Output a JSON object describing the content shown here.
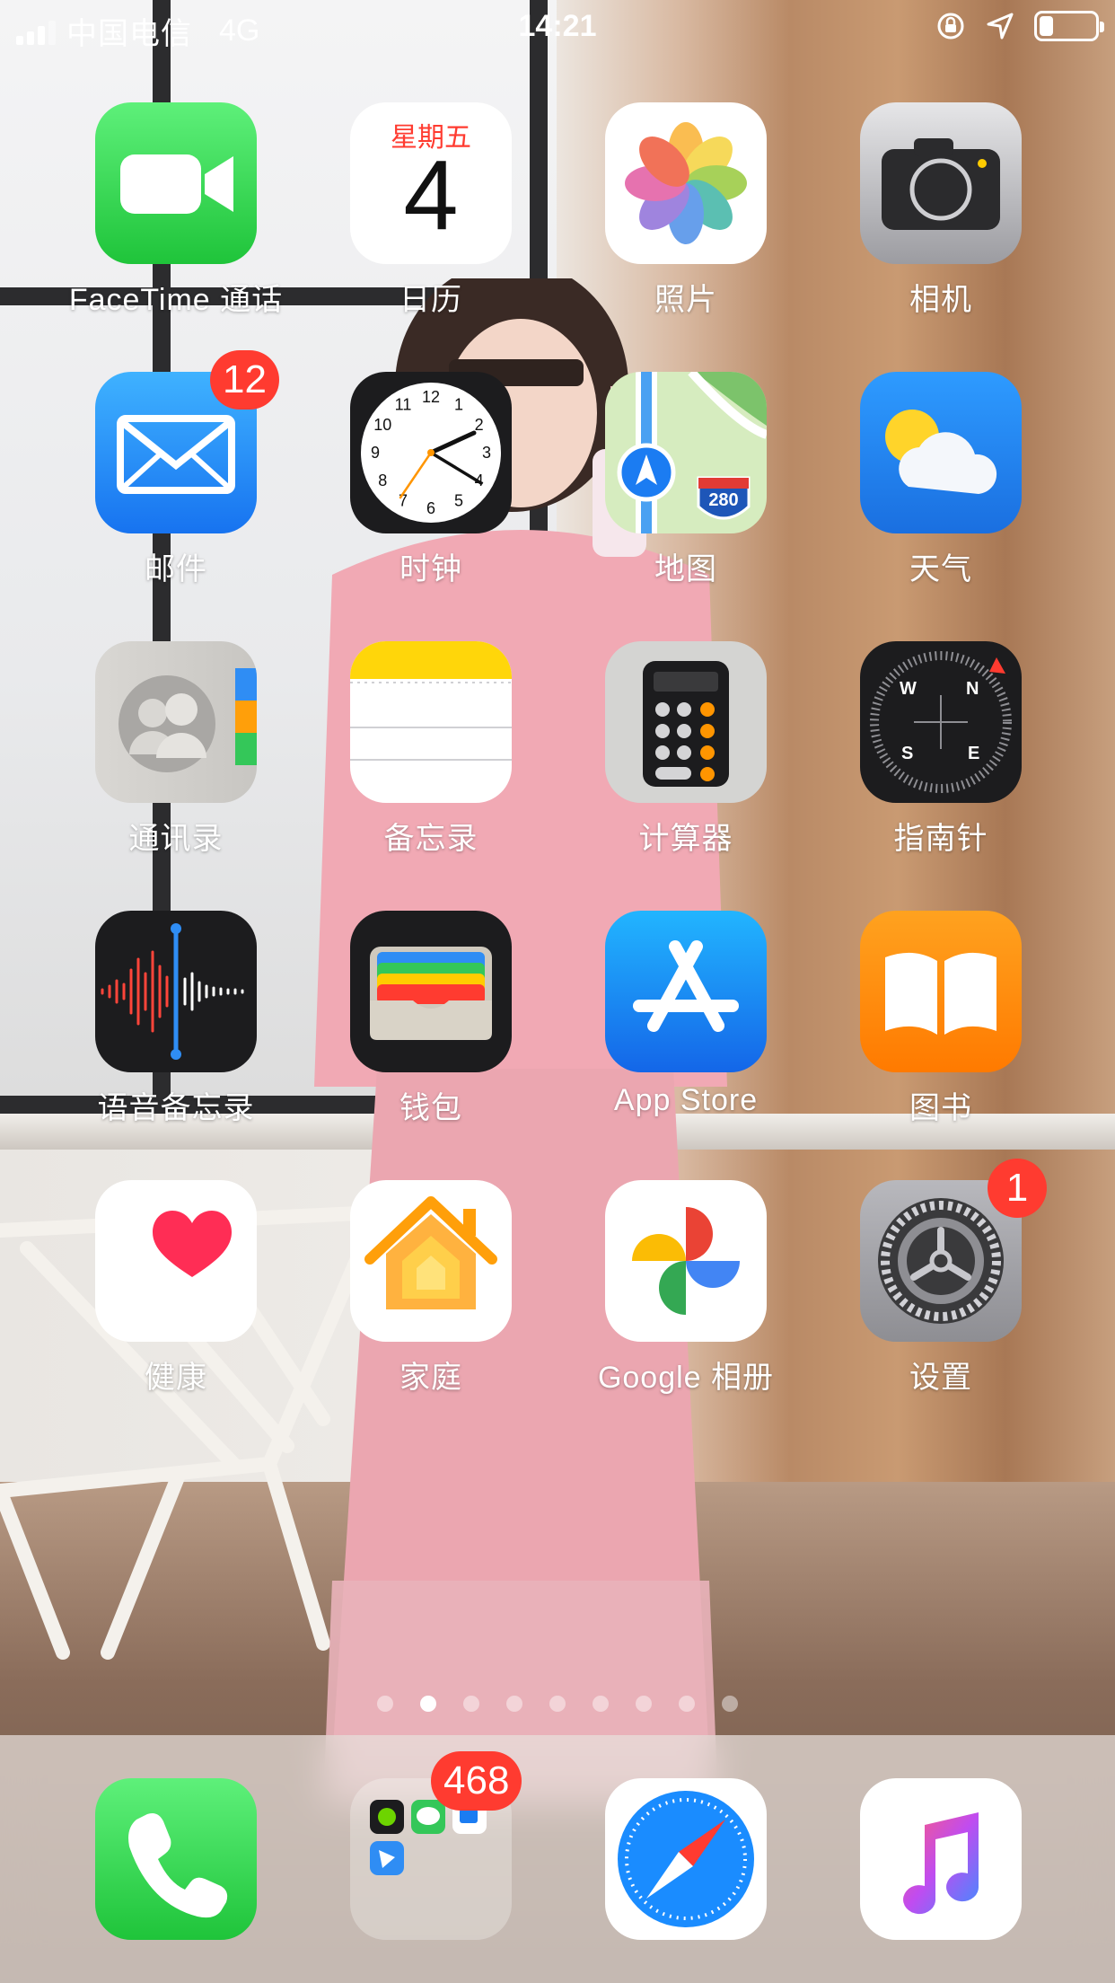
{
  "status_bar": {
    "carrier": "中国电信",
    "network": "4G",
    "time": "14:21",
    "icons": [
      "signal-icon",
      "orientation-lock-icon",
      "location-arrow-icon",
      "battery-icon"
    ],
    "battery_level": 0.25
  },
  "calendar": {
    "weekday": "星期五",
    "day": "4"
  },
  "apps": [
    {
      "id": "facetime",
      "label": "FaceTime 通话",
      "icon": "facetime-icon"
    },
    {
      "id": "calendar",
      "label": "日历",
      "icon": "calendar-icon"
    },
    {
      "id": "photos",
      "label": "照片",
      "icon": "photos-icon"
    },
    {
      "id": "camera",
      "label": "相机",
      "icon": "camera-icon"
    },
    {
      "id": "mail",
      "label": "邮件",
      "icon": "mail-icon",
      "badge": "12"
    },
    {
      "id": "clock",
      "label": "时钟",
      "icon": "clock-icon"
    },
    {
      "id": "maps",
      "label": "地图",
      "icon": "maps-icon",
      "route": "280"
    },
    {
      "id": "weather",
      "label": "天气",
      "icon": "weather-icon"
    },
    {
      "id": "contacts",
      "label": "通讯录",
      "icon": "contacts-icon"
    },
    {
      "id": "notes",
      "label": "备忘录",
      "icon": "notes-icon"
    },
    {
      "id": "calculator",
      "label": "计算器",
      "icon": "calculator-icon"
    },
    {
      "id": "compass",
      "label": "指南针",
      "icon": "compass-icon",
      "directions": [
        "W",
        "N",
        "S",
        "E"
      ]
    },
    {
      "id": "voice-memos",
      "label": "语音备忘录",
      "icon": "voice-memos-icon"
    },
    {
      "id": "wallet",
      "label": "钱包",
      "icon": "wallet-icon"
    },
    {
      "id": "app-store",
      "label": "App Store",
      "icon": "app-store-icon"
    },
    {
      "id": "books",
      "label": "图书",
      "icon": "books-icon"
    },
    {
      "id": "health",
      "label": "健康",
      "icon": "health-icon"
    },
    {
      "id": "home",
      "label": "家庭",
      "icon": "home-icon"
    },
    {
      "id": "google-photos",
      "label": "Google 相册",
      "icon": "google-photos-icon"
    },
    {
      "id": "settings",
      "label": "设置",
      "icon": "settings-icon",
      "badge": "1"
    }
  ],
  "clock_numbers": [
    "12",
    "1",
    "2",
    "3",
    "4",
    "5",
    "6",
    "7",
    "8",
    "9",
    "10",
    "11"
  ],
  "page_dots": {
    "count": 9,
    "active_index": 1
  },
  "dock": [
    {
      "id": "phone",
      "icon": "phone-icon"
    },
    {
      "id": "folder",
      "icon": "folder-icon",
      "badge": "468"
    },
    {
      "id": "safari",
      "icon": "safari-icon"
    },
    {
      "id": "music",
      "icon": "music-icon"
    }
  ],
  "colors": {
    "badge": "#ff3b30",
    "facetime_green": "#34c759",
    "mail_blue": "#1a8cff",
    "label_white": "#ffffff"
  }
}
